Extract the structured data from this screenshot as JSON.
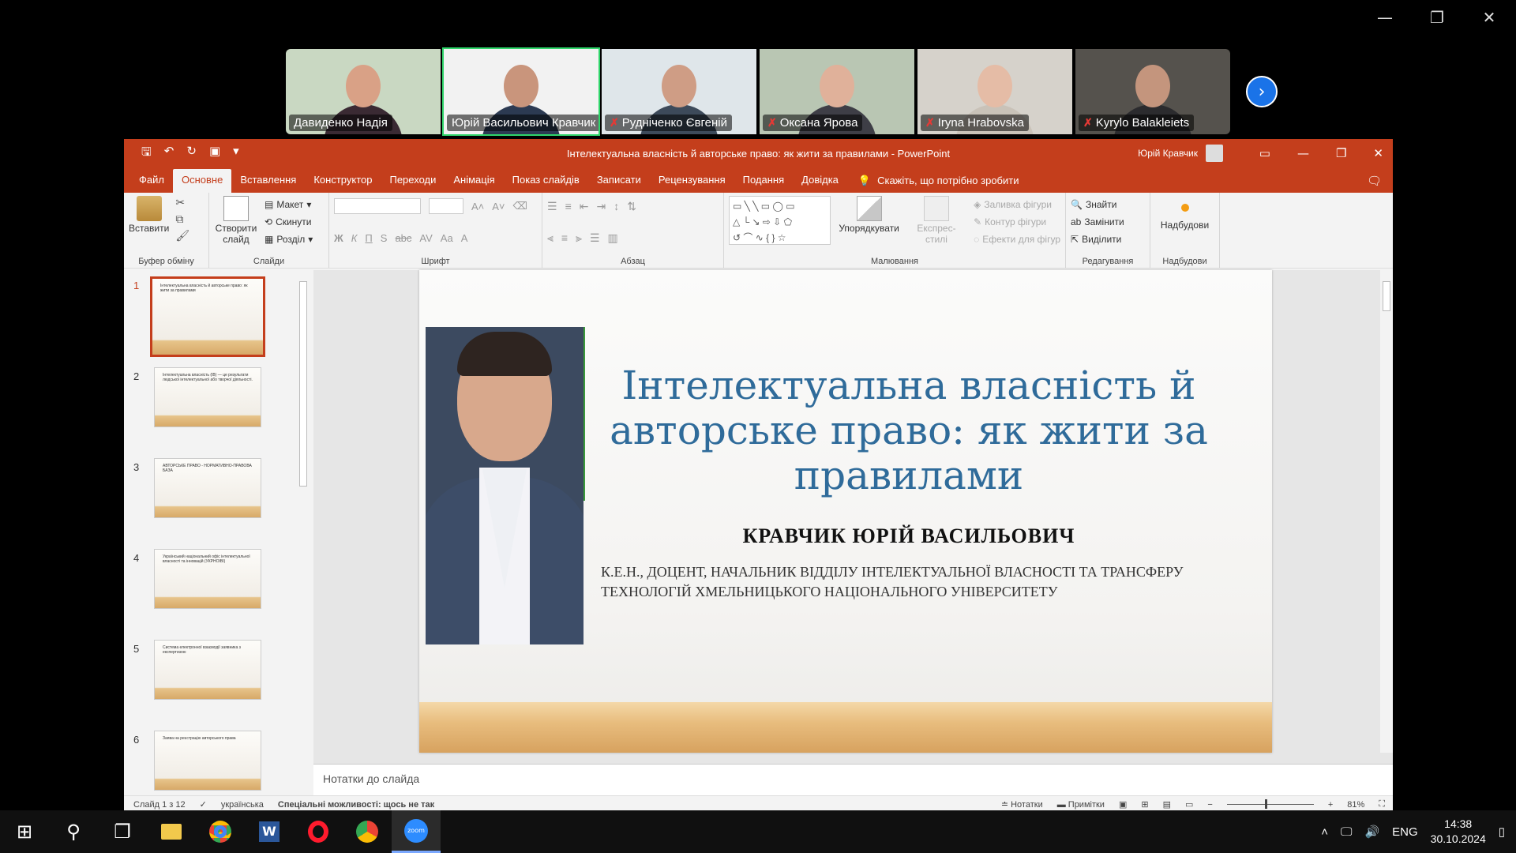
{
  "zoom": {
    "window_controls": {
      "minimize": "—",
      "restore": "❐",
      "close": "✕"
    },
    "participants": [
      {
        "name": "Давиденко Надія",
        "muted": false,
        "active": false,
        "bg": "#c9d8c2",
        "skin": "#d9a186",
        "shirt": "#3a2a33"
      },
      {
        "name": "Юрій Васильович Кравчик",
        "muted": false,
        "active": true,
        "bg": "#f2f2f2",
        "skin": "#c9957c",
        "shirt": "#2c3a52"
      },
      {
        "name": "Рудніченко Євгеній",
        "muted": true,
        "active": false,
        "bg": "#dfe6ea",
        "skin": "#cf9d85",
        "shirt": "#3d4a5a"
      },
      {
        "name": "Оксана Ярова",
        "muted": true,
        "active": false,
        "bg": "#b9c6b3",
        "skin": "#e0b19a",
        "shirt": "#3e3e46"
      },
      {
        "name": "Iryna  Hrabovska",
        "muted": true,
        "active": false,
        "bg": "#d6d2cb",
        "skin": "#e5bca6",
        "shirt": "#c9c2b8"
      },
      {
        "name": "Kyrylo Balakleiets",
        "muted": true,
        "active": false,
        "bg": "#55524d",
        "skin": "#c4957d",
        "shirt": "#2b2b2e"
      }
    ],
    "mic_muted_icon": "✗",
    "next_icon": "›"
  },
  "ppt": {
    "window_title": "Інтелектуальна власність й авторське право: як жити за правилами  -  PowerPoint",
    "user_name": "Юрій Кравчик",
    "tabs": [
      "Файл",
      "Основне",
      "Вставлення",
      "Конструктор",
      "Переходи",
      "Анімація",
      "Показ слайдів",
      "Записати",
      "Рецензування",
      "Подання",
      "Довідка"
    ],
    "selected_tab": "Основне",
    "tell_me": "Скажіть, що потрібно зробити",
    "ribbon": {
      "clipboard": {
        "paste": "Вставити",
        "label": "Буфер обміну"
      },
      "slides": {
        "new_slide": "Створити слайд",
        "layout": "Макет",
        "reset": "Скинути",
        "section": "Розділ",
        "label": "Слайди"
      },
      "font": {
        "label": "Шрифт",
        "bold": "Ж",
        "italic": "К",
        "underline": "П",
        "shadow": "S",
        "strike": "abc"
      },
      "paragraph": {
        "label": "Абзац"
      },
      "drawing": {
        "arrange": "Упорядкувати",
        "quick_styles": "Експрес-стилі",
        "fill": "Заливка фігури",
        "outline": "Контур фігури",
        "effects": "Ефекти для фігур",
        "label": "Малювання"
      },
      "editing": {
        "find": "Знайти",
        "replace": "Замінити",
        "select": "Виділити",
        "label": "Редагування"
      },
      "addins": {
        "addins": "Надбудови",
        "label": "Надбудови"
      }
    },
    "thumbnails": [
      {
        "num": "1",
        "text": "Інтелектуальна власність й авторське право: як жити за правилами"
      },
      {
        "num": "2",
        "text": "Інтелектуальна власність (ІВ) — це результати людської інтелектуальної або творчої діяльності."
      },
      {
        "num": "3",
        "text": "АВТОРСЬКЕ ПРАВО - НОРМАТИВНО-ПРАВОВА БАЗА"
      },
      {
        "num": "4",
        "text": "Український національний офіс інтелектуальної власності та інновацій (УКРНОІВІ)"
      },
      {
        "num": "5",
        "text": "Система електронної взаємодії заявника з експертизою"
      },
      {
        "num": "6",
        "text": "Заява на реєстрацію авторського права"
      }
    ],
    "slide": {
      "title": "Інтелектуальна власність й авторське право: як жити за правилами",
      "author": "КРАВЧИК ЮРІЙ ВАСИЛЬОВИЧ",
      "description": "К.Е.Н., ДОЦЕНТ, НАЧАЛЬНИК ВІДДІЛУ ІНТЕЛЕКТУАЛЬНОЇ ВЛАСНОСТІ ТА ТРАНСФЕРУ ТЕХНОЛОГІЙ ХМЕЛЬНИЦЬКОГО НАЦІОНАЛЬНОГО УНІВЕРСИТЕТУ"
    },
    "notes_placeholder": "Нотатки до слайда",
    "status": {
      "slide_counter": "Слайд 1 з 12",
      "language": "українська",
      "accessibility": "Спеціальні можливості: щось не так",
      "notes_btn": "Нотатки",
      "comments_btn": "Примітки",
      "zoom_level": "81%"
    }
  },
  "taskbar": {
    "apps": [
      "windows-start",
      "search",
      "task-view",
      "file-explorer",
      "chrome",
      "word",
      "opera",
      "chrome-profile",
      "zoom"
    ],
    "language": "ENG",
    "time": "14:38",
    "date": "30.10.2024"
  }
}
